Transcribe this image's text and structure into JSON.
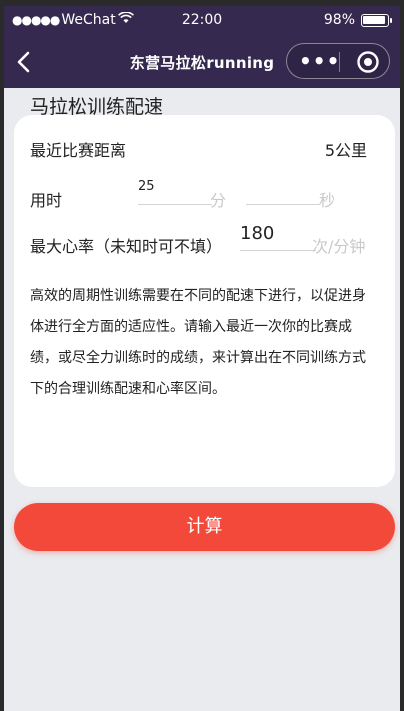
{
  "status_bar": {
    "carrier": "WeChat",
    "time": "22:00",
    "battery_text": "98%",
    "battery_level": 0.98
  },
  "nav": {
    "title": "东营马拉松running",
    "back_icon": "chevron-left-icon",
    "more_icon": "more-dots-icon",
    "close_icon": "target-circle-icon"
  },
  "section_title": "马拉松训练配速",
  "form": {
    "distance": {
      "label": "最近比赛距离",
      "value": "5公里"
    },
    "time": {
      "label": "用时",
      "minutes_value": "25",
      "minutes_unit": "分",
      "seconds_value": "",
      "seconds_unit": "秒"
    },
    "heart_rate": {
      "label": "最大心率（未知时可不填）",
      "value": "180",
      "unit": "次/分钟"
    }
  },
  "description": "高效的周期性训练需要在不同的配速下进行，以促进身体进行全方面的适应性。请输入最近一次你的比赛成绩，或尽全力训练时的成绩，来计算出在不同训练方式下的合理训练配速和心率区间。",
  "actions": {
    "calculate_label": "计算"
  },
  "colors": {
    "nav_bg": "#35294f",
    "accent": "#f2493a",
    "page_bg": "#e9ebef"
  }
}
